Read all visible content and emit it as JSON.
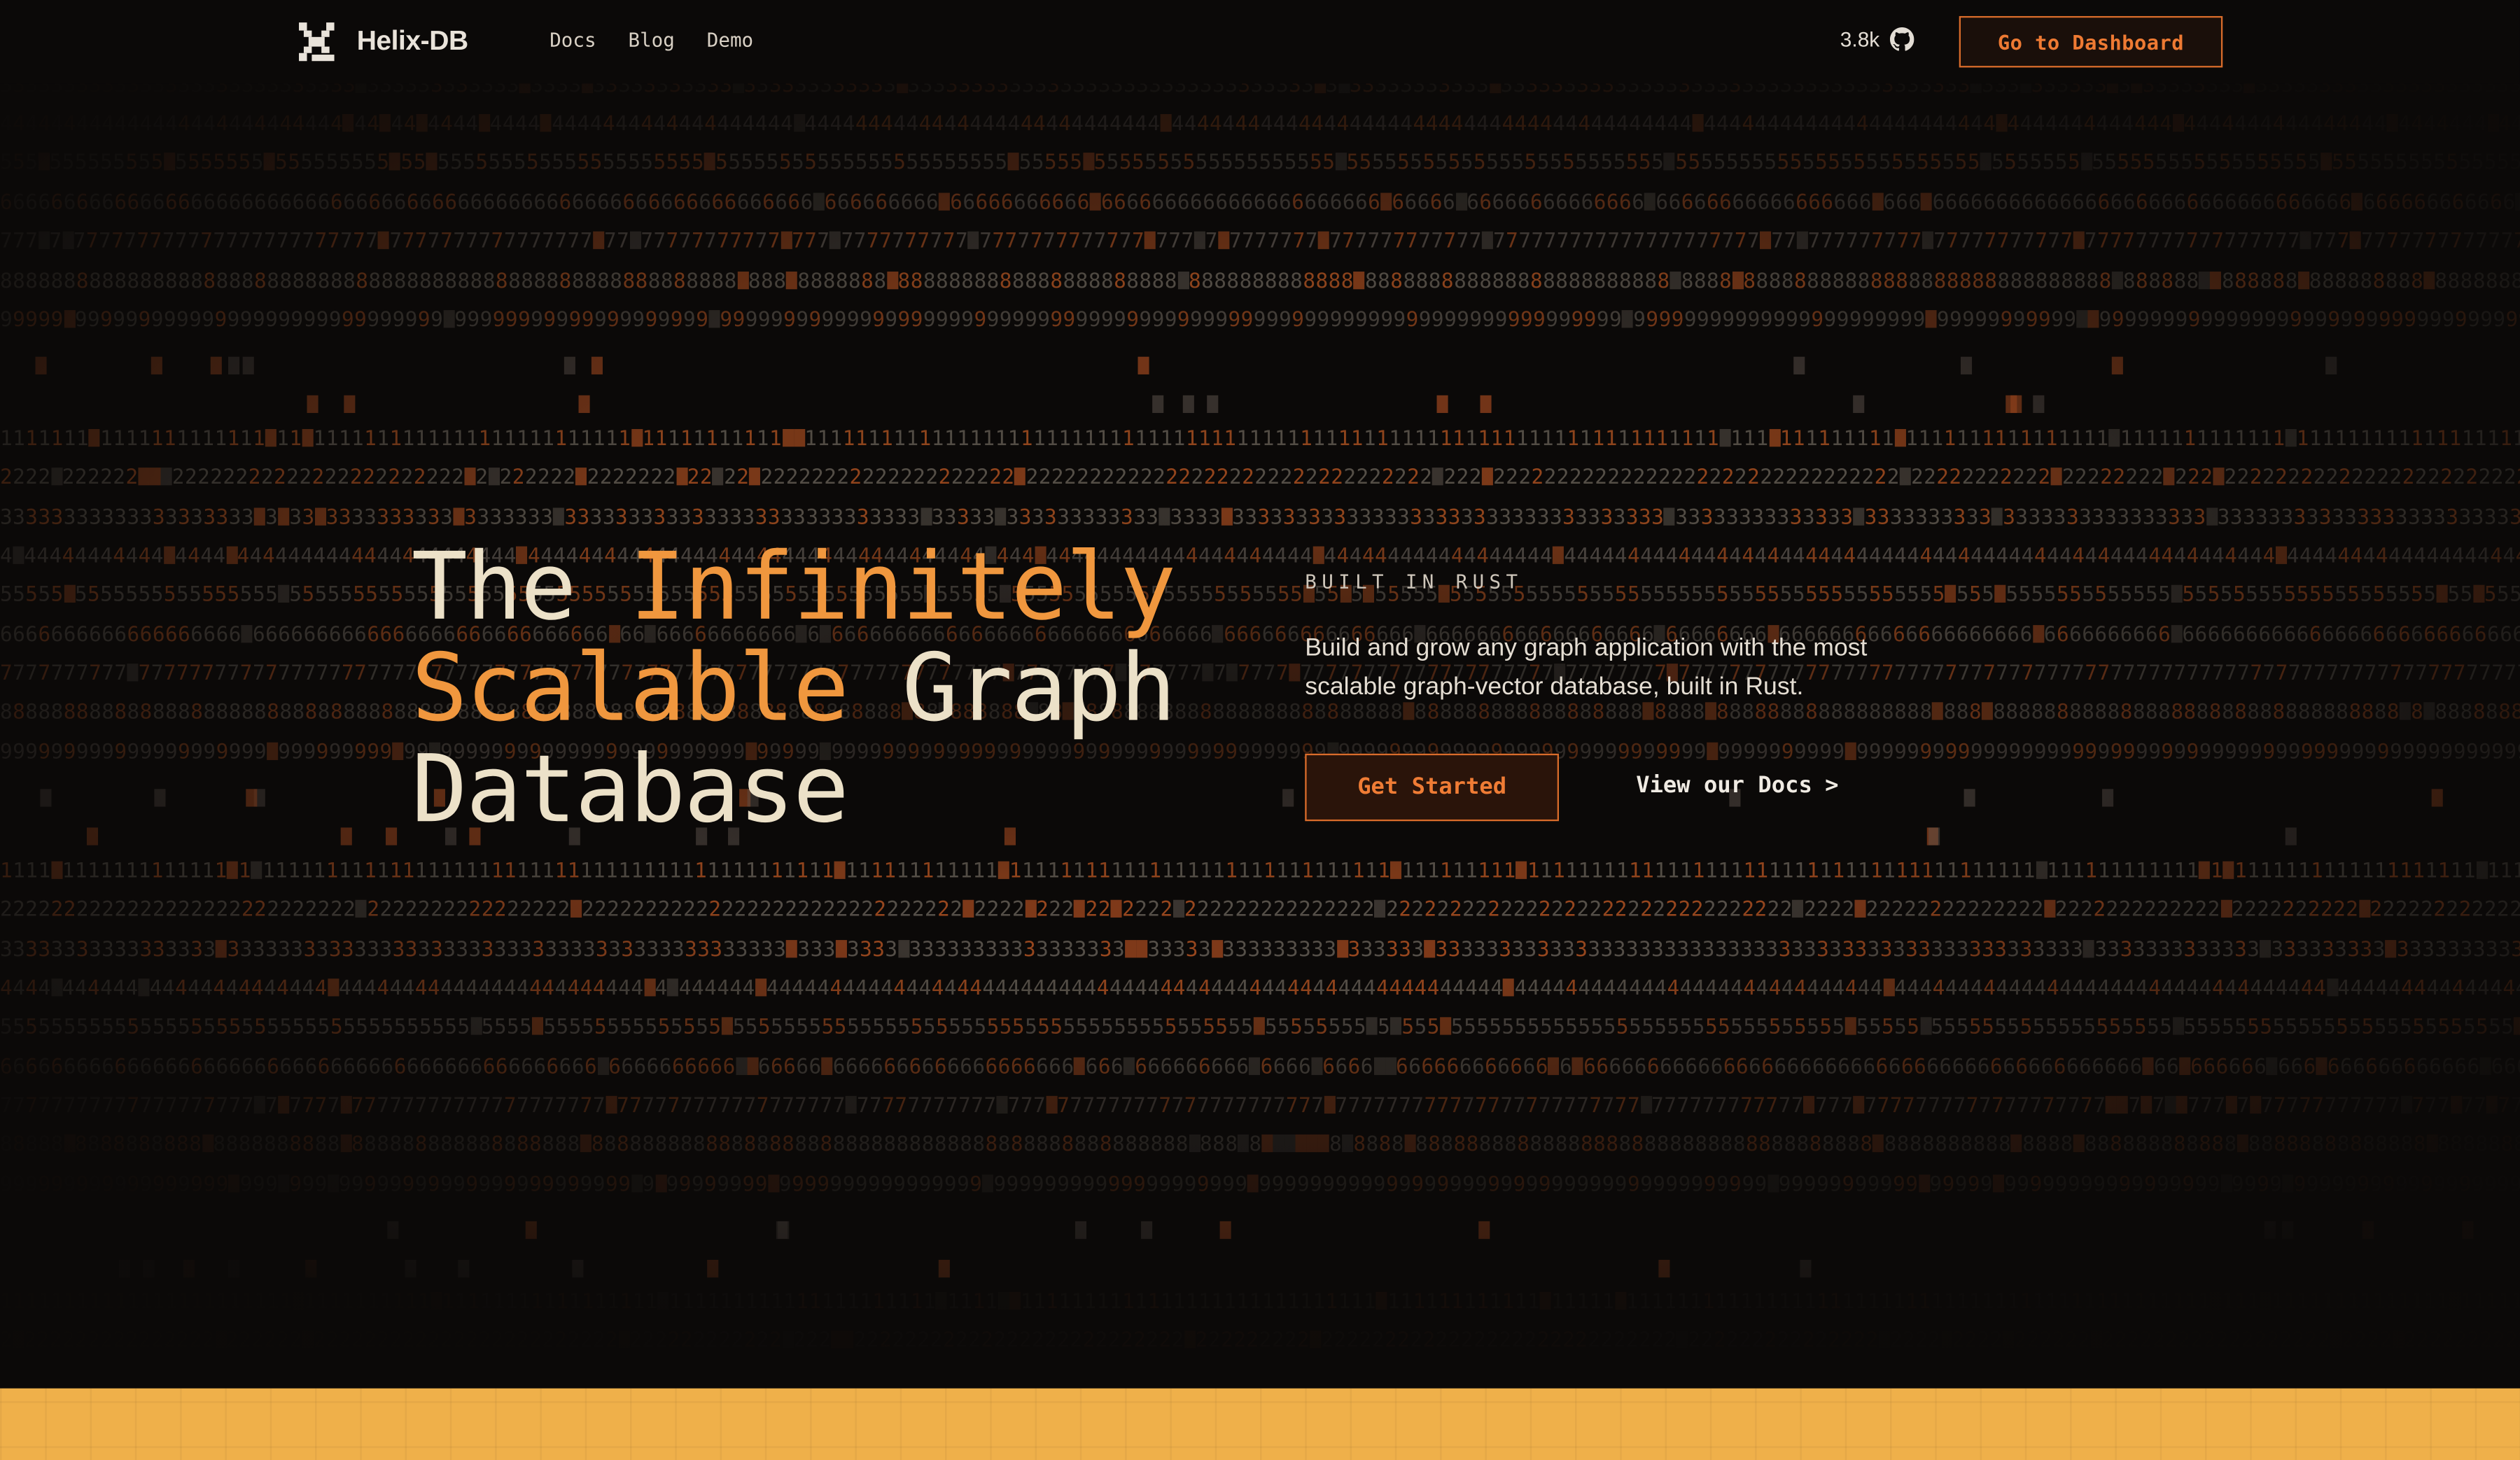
{
  "brand": {
    "name": "Helix-DB",
    "logo_icon": "helix-logo-icon"
  },
  "nav": {
    "links": [
      {
        "label": "Docs"
      },
      {
        "label": "Blog"
      },
      {
        "label": "Demo"
      }
    ],
    "github_stars": "3.8k",
    "github_icon": "github-icon",
    "dashboard_label": "Go to Dashboard"
  },
  "hero": {
    "title_part1": "The",
    "title_accent1": "Infinitely",
    "title_accent2": "Scalable",
    "title_part2": "Graph",
    "title_part3": "Database",
    "eyebrow": "BUILT IN RUST",
    "description": "Build and grow any graph application with the most scalable graph-vector database, built in Rust.",
    "primary_cta": "Get Started",
    "secondary_cta": "View our Docs",
    "secondary_chevron": ">"
  },
  "colors": {
    "background": "#0b0908",
    "accent_orange": "#f0973e",
    "button_border": "#d96c2b",
    "title_cream": "#ece1c8",
    "band_yellow": "#efb04a"
  }
}
